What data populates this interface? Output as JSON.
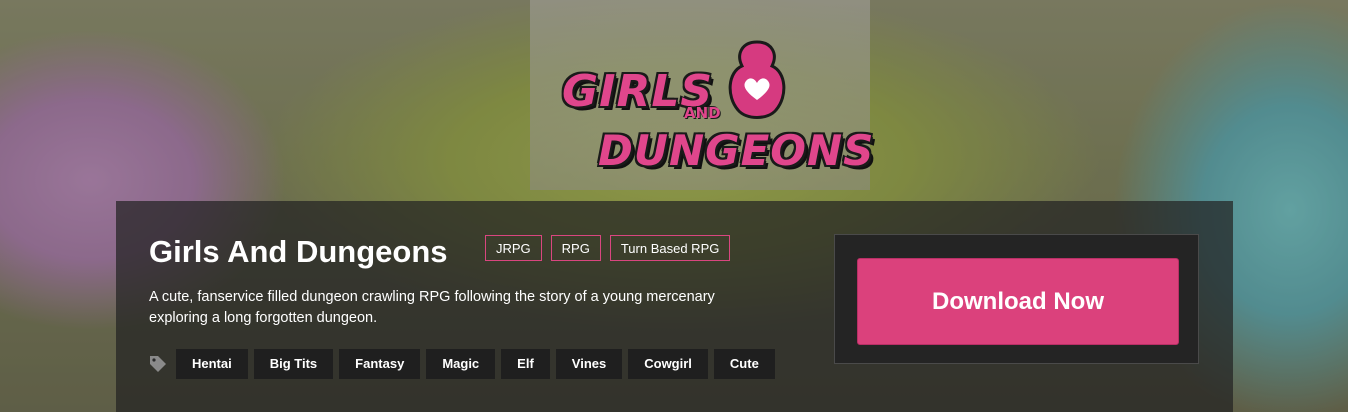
{
  "logo": {
    "line1": "GIRLS",
    "and": "AND",
    "line2": "DUNGEONS"
  },
  "game": {
    "title": "Girls And Dungeons",
    "genres": [
      "JRPG",
      "RPG",
      "Turn Based RPG"
    ],
    "description": "A cute, fanservice filled dungeon crawling RPG following the story of a young mercenary exploring a long forgotten dungeon.",
    "tags": [
      "Hentai",
      "Big Tits",
      "Fantasy",
      "Magic",
      "Elf",
      "Vines",
      "Cowgirl",
      "Cute"
    ]
  },
  "download": {
    "label": "Download Now"
  },
  "icons": {
    "tags": "tag-icon"
  },
  "colors": {
    "accent": "#db417c",
    "genre_border": "#d9467f",
    "tag_bg": "#1f1f1f"
  }
}
